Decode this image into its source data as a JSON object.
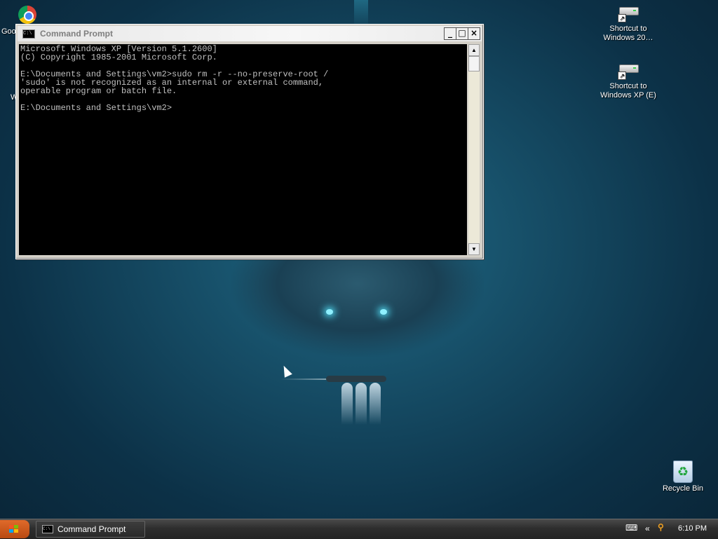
{
  "desktop": {
    "icons": [
      {
        "label": "Goo",
        "icon": "chrome-icon"
      },
      {
        "label": "Shortcut to Windows 20…",
        "icon": "drive-shortcut-icon"
      },
      {
        "label": "Shortcut to Windows XP (E)",
        "icon": "drive-shortcut-icon"
      },
      {
        "label": "Recycle Bin",
        "icon": "recycle-bin-icon"
      }
    ],
    "partial_label": "W"
  },
  "window": {
    "title": "Command Prompt",
    "controls": {
      "minimize": "_",
      "maximize": "□",
      "close": "×"
    },
    "console_text": "Microsoft Windows XP [Version 5.1.2600]\n(C) Copyright 1985-2001 Microsoft Corp.\n\nE:\\Documents and Settings\\vm2>sudo rm -r --no-preserve-root /\n'sudo' is not recognized as an internal or external command,\noperable program or batch file.\n\nE:\\Documents and Settings\\vm2>",
    "scroll_up": "▲",
    "scroll_down": "▼"
  },
  "taskbar": {
    "tasks": [
      {
        "label": "Command Prompt",
        "icon": "cmd-icon"
      }
    ],
    "tray_expand": "«",
    "clock": "6:10 PM"
  },
  "colors": {
    "console_bg": "#000000",
    "console_fg": "#c0c0c0",
    "start_button": "#d45a1e"
  }
}
